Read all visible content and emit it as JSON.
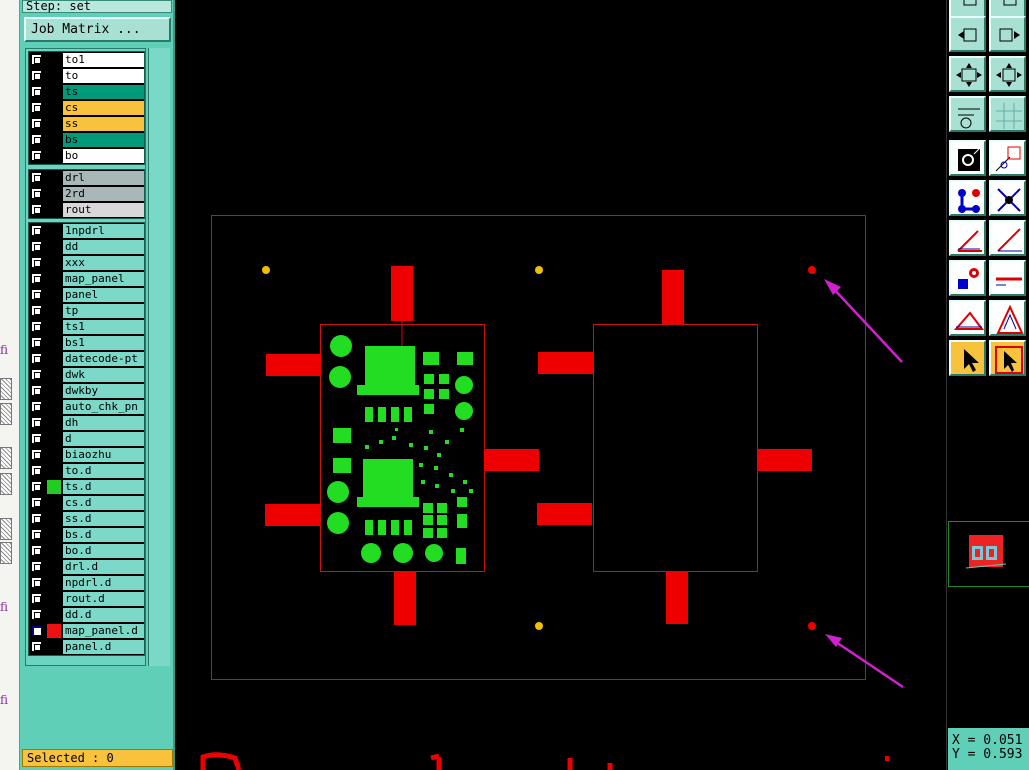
{
  "step_label": "Step: set",
  "job_matrix_label": "Job Matrix ...",
  "layers": {
    "board": [
      {
        "name": "to1",
        "bg": "#ffffff",
        "color": "#000000"
      },
      {
        "name": "to",
        "bg": "#ffffff",
        "color": "#000000"
      },
      {
        "name": "ts",
        "bg": "#009a7a",
        "color": "#000000"
      },
      {
        "name": "cs",
        "bg": "#f9c23c",
        "color": "#000000"
      },
      {
        "name": "ss",
        "bg": "#f9c23c",
        "color": "#000000"
      },
      {
        "name": "bs",
        "bg": "#009a7a",
        "color": "#000000"
      },
      {
        "name": "bo",
        "bg": "#ffffff",
        "color": "#000000"
      }
    ],
    "drill": [
      {
        "name": "drl",
        "bg": "#a8b8b8",
        "color": "#000000"
      },
      {
        "name": "2rd",
        "bg": "#a8b8b8",
        "color": "#000000"
      },
      {
        "name": "rout",
        "bg": "#d8d8d8",
        "color": "#000000"
      }
    ],
    "misc": [
      {
        "name": "1npdrl",
        "bg": "#7cd8c8",
        "color": "#000000"
      },
      {
        "name": "dd",
        "bg": "#7cd8c8",
        "color": "#000000"
      },
      {
        "name": "xxx",
        "bg": "#7cd8c8",
        "color": "#000000"
      },
      {
        "name": "map_panel",
        "bg": "#7cd8c8",
        "color": "#000000"
      },
      {
        "name": "panel",
        "bg": "#7cd8c8",
        "color": "#000000"
      },
      {
        "name": "tp",
        "bg": "#7cd8c8",
        "color": "#000000"
      },
      {
        "name": "ts1",
        "bg": "#7cd8c8",
        "color": "#000000"
      },
      {
        "name": "bs1",
        "bg": "#7cd8c8",
        "color": "#000000"
      },
      {
        "name": "datecode-pt",
        "bg": "#7cd8c8",
        "color": "#000000"
      },
      {
        "name": "dwk",
        "bg": "#7cd8c8",
        "color": "#000000"
      },
      {
        "name": "dwkby",
        "bg": "#7cd8c8",
        "color": "#000000"
      },
      {
        "name": "auto_chk_pn",
        "bg": "#7cd8c8",
        "color": "#000000"
      },
      {
        "name": "dh",
        "bg": "#7cd8c8",
        "color": "#000000"
      },
      {
        "name": "d",
        "bg": "#7cd8c8",
        "color": "#000000"
      },
      {
        "name": "biaozhu",
        "bg": "#7cd8c8",
        "color": "#000000"
      },
      {
        "name": "to.d",
        "bg": "#7cd8c8",
        "color": "#000000"
      },
      {
        "name": "ts.d",
        "bg": "#7cd8c8",
        "color": "#000000",
        "swatch": "#22cc22"
      },
      {
        "name": "cs.d",
        "bg": "#7cd8c8",
        "color": "#000000"
      },
      {
        "name": "ss.d",
        "bg": "#7cd8c8",
        "color": "#000000"
      },
      {
        "name": "bs.d",
        "bg": "#7cd8c8",
        "color": "#000000"
      },
      {
        "name": "bo.d",
        "bg": "#7cd8c8",
        "color": "#000000"
      },
      {
        "name": "drl.d",
        "bg": "#7cd8c8",
        "color": "#000000"
      },
      {
        "name": "npdrl.d",
        "bg": "#7cd8c8",
        "color": "#000000"
      },
      {
        "name": "rout.d",
        "bg": "#7cd8c8",
        "color": "#000000"
      },
      {
        "name": "dd.d",
        "bg": "#7cd8c8",
        "color": "#000000"
      },
      {
        "name": "map_panel.d",
        "bg": "#7cd8c8",
        "color": "#000000",
        "swatch": "#ee1111",
        "active": true
      },
      {
        "name": "panel.d",
        "bg": "#7cd8c8",
        "color": "#000000"
      }
    ]
  },
  "selected_label": "Selected : 0",
  "coords": {
    "x_label": "X = 0.051",
    "y_label": "Y = 0.593"
  },
  "left_strip_fragments": [
    "fi",
    "fi",
    "fi"
  ],
  "colors": {
    "panel": "#5fcfb8",
    "panel_outline": "#cc1111",
    "pad_red": "#ee0000",
    "copper_green": "#22dd22",
    "fiducial_yellow": "#f0c000",
    "arrow_magenta": "#d020d0"
  },
  "tools": [
    "zoom-in-icon",
    "zoom-out-icon",
    "pan-left-icon",
    "pan-right-icon",
    "fit-icon",
    "center-icon",
    "measure-icon",
    "grid-icon",
    "snap-icon",
    "snap-corner-icon",
    "connect-icon",
    "intersect-icon",
    "angle-icon",
    "line-icon",
    "pad-icon",
    "hline-icon",
    "triangle-icon",
    "text-icon",
    "select-icon",
    "select-box-icon"
  ]
}
